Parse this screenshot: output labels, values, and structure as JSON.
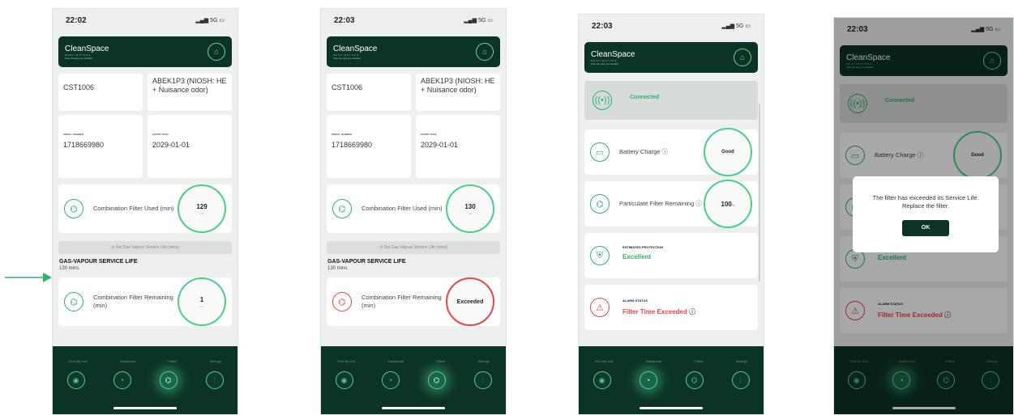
{
  "screens": [
    {
      "time": "22:02",
      "signal": "5G",
      "brand": "CleanSpace",
      "brand_sub": "RESPIRATORS",
      "brand_tag": "Free the way you breathe",
      "model": "CST1006",
      "filter_type": "ABEK1P3 (NIOSH: HE + Nuisance odor)",
      "serial_label": "SERIAL NUMBER",
      "serial": "1718669980",
      "expiry_label": "EXPIRY DATE",
      "expiry": "2029-01-01",
      "used_label": "Combination Filter Used (min)",
      "used_value": "129",
      "used_unit": "min",
      "set_label": "Set Gas-Vapour Service Life (mins)",
      "gv_title": "GAS-VAPOUR SERVICE LIFE",
      "gv_value": "130 mins",
      "remaining_label": "Combination Filter Remaining (min)",
      "remaining_value": "1",
      "remaining_unit": "min"
    },
    {
      "time": "22:03",
      "signal": "5G",
      "brand": "CleanSpace",
      "brand_sub": "RESPIRATORS",
      "brand_tag": "Free the way you breathe",
      "model": "CST1006",
      "filter_type": "ABEK1P3 (NIOSH: HE + Nuisance odor)",
      "serial_label": "SERIAL NUMBER",
      "serial": "1718669980",
      "expiry_label": "EXPIRY DATE",
      "expiry": "2029-01-01",
      "used_label": "Combination Filter Used (min)",
      "used_value": "130",
      "used_unit": "min",
      "set_label": "Set Gas-Vapour Service Life (mins)",
      "gv_title": "GAS-VAPOUR SERVICE LIFE",
      "gv_value": "130 mins",
      "remaining_label": "Combination Filter Remaining (min)",
      "remaining_value": "Exceeded"
    },
    {
      "time": "22:03",
      "signal": "5G",
      "brand": "CleanSpace",
      "brand_sub": "RESPIRATORS",
      "brand_tag": "Free the way you breathe",
      "connected": "Connected",
      "battery_label": "Battery Charge",
      "battery_value": "Good",
      "particulate_label": "Particulate Filter Remaining",
      "particulate_value": "100",
      "particulate_unit": "%",
      "protection_title": "ESTIMATED PROTECTION",
      "protection_value": "Excellent",
      "alarm_title": "ALARM STATUS",
      "alarm_value": "Filter Time Exceeded"
    },
    {
      "time": "22:03",
      "signal": "5G",
      "brand": "CleanSpace",
      "brand_sub": "RESPIRATORS",
      "brand_tag": "Free the way you breathe",
      "connected": "Connected",
      "battery_label": "Battery Charge",
      "battery_value": "Good",
      "protection_value": "Excellent",
      "alarm_title": "ALARM STATUS",
      "alarm_value": "Filter Time Exceeded",
      "dialog_message": "The filter has exceeded its Service Life. Replace the filter.",
      "dialog_ok": "OK"
    }
  ],
  "nav": {
    "find": "Find My Unit",
    "dashboard": "Dashboard",
    "filters": "Filters",
    "settings": "Settings"
  },
  "colors": {
    "brand_dark": "#0b3326",
    "accent_green": "#47d086",
    "alert_red": "#e84545"
  },
  "icons": [
    "location-pin-icon",
    "dashboard-gauge-icon",
    "filter-icon",
    "settings-sliders-icon",
    "home-icon",
    "battery-icon",
    "signal-icon",
    "shield-icon",
    "warning-triangle-icon",
    "info-icon"
  ]
}
